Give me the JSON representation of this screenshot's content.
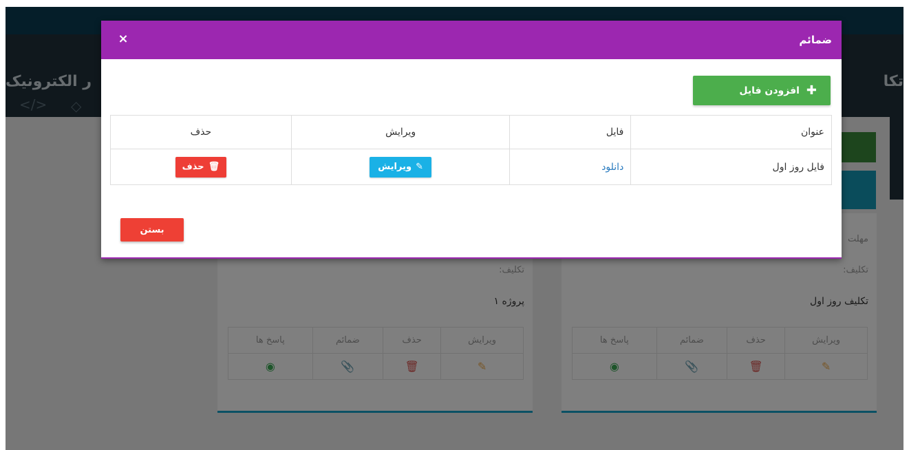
{
  "background": {
    "app_title_left": "ر الکترونیک",
    "app_title_right": "تکا",
    "card_left": {
      "line_task": "تکلیف:",
      "line_project": "پروژه ۱",
      "headers": [
        "ویرایش",
        "حذف",
        "ضمائم",
        "پاسخ ها"
      ],
      "icons": [
        "edit-icon",
        "trash-icon",
        "paperclip-icon",
        "eye-icon"
      ]
    },
    "card_right": {
      "line_cut": "مهلت",
      "line_task": "تکلیف:",
      "line_name": "تکلیف روز اول",
      "headers": [
        "ویرایش",
        "حذف",
        "ضمائم",
        "پاسخ ها"
      ],
      "icons": [
        "edit-icon",
        "trash-icon",
        "paperclip-icon",
        "eye-icon"
      ]
    }
  },
  "modal": {
    "title": "ضمائم",
    "close_glyph": "×",
    "add_file_label": "افزودن فایل",
    "table": {
      "headers": {
        "title": "عنوان",
        "file": "فایل",
        "edit": "ویرایش",
        "delete": "حذف"
      },
      "rows": [
        {
          "title": "فایل روز اول",
          "file_link": "دانلود",
          "edit_label": "ویرایش",
          "delete_label": "حذف"
        }
      ]
    },
    "close_label": "بستن"
  },
  "colors": {
    "modal_header": "#9c27b0",
    "add_button": "#4cae4c",
    "edit_button": "#1ab1e6",
    "delete_button": "#ee3e36",
    "close_button": "#ee4035",
    "link": "#2a7bbf"
  }
}
